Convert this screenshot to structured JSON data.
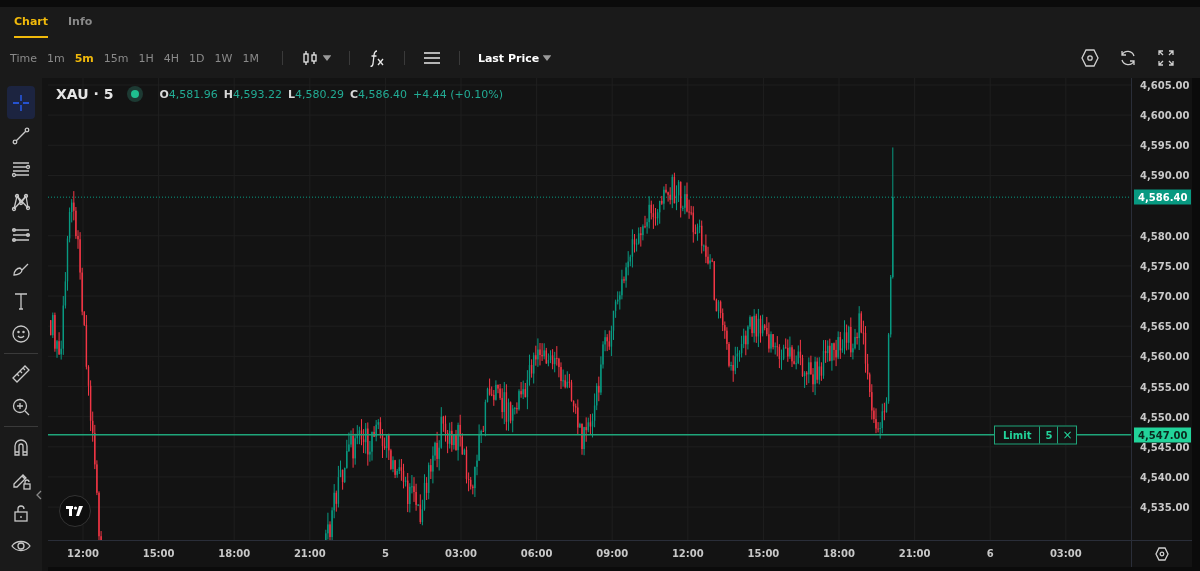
{
  "tabs": [
    {
      "label": "Chart",
      "selected": true
    },
    {
      "label": "Info",
      "selected": false
    }
  ],
  "toolbar": {
    "intervals_label": "Time",
    "intervals": [
      {
        "label": "1m",
        "selected": false
      },
      {
        "label": "5m",
        "selected": true
      },
      {
        "label": "15m",
        "selected": false
      },
      {
        "label": "1H",
        "selected": false
      },
      {
        "label": "4H",
        "selected": false
      },
      {
        "label": "1D",
        "selected": false
      },
      {
        "label": "1W",
        "selected": false
      },
      {
        "label": "1M",
        "selected": false
      }
    ],
    "price_source": "Last Price"
  },
  "drawing_tools": [
    {
      "kind": "crosshair",
      "selected": true
    },
    {
      "kind": "trend-line",
      "selected": false
    },
    {
      "kind": "parallel-lines",
      "selected": false
    },
    {
      "kind": "pattern",
      "selected": false
    },
    {
      "kind": "fib",
      "selected": false
    },
    {
      "kind": "brush",
      "selected": false
    },
    {
      "kind": "text",
      "selected": false
    },
    {
      "kind": "emoji",
      "selected": false
    },
    {
      "kind": "divider"
    },
    {
      "kind": "ruler",
      "selected": false
    },
    {
      "kind": "zoom",
      "selected": false
    },
    {
      "kind": "divider"
    },
    {
      "kind": "magnet",
      "selected": false
    },
    {
      "kind": "pencil-lock",
      "selected": false
    },
    {
      "kind": "lock",
      "selected": false
    },
    {
      "kind": "eye",
      "selected": false
    }
  ],
  "legend": {
    "symbol": "XAU · 5",
    "ohlc": [
      {
        "label": "O",
        "value": "4,581.96"
      },
      {
        "label": "H",
        "value": "4,593.22"
      },
      {
        "label": "L",
        "value": "4,580.29"
      },
      {
        "label": "C",
        "value": "4,586.40"
      }
    ],
    "change": "+4.44 (+0.10%)"
  },
  "price_axis": {
    "ticks": [
      "4,605.00",
      "4,600.00",
      "4,595.00",
      "4,590.00",
      "4,580.00",
      "4,575.00",
      "4,570.00",
      "4,565.00",
      "4,560.00",
      "4,555.00",
      "4,550.00",
      "4,545.00",
      "4,540.00",
      "4,535.00"
    ],
    "last_price": "4,586.40",
    "order_price": "4,547.00"
  },
  "order": {
    "type": "Limit",
    "quantity": "5",
    "close": "×"
  },
  "time_axis": {
    "labels": [
      "12:00",
      "15:00",
      "18:00",
      "21:00",
      "5",
      "03:00",
      "06:00",
      "09:00",
      "12:00",
      "15:00",
      "18:00",
      "21:00",
      "6",
      "03:00"
    ]
  }
}
